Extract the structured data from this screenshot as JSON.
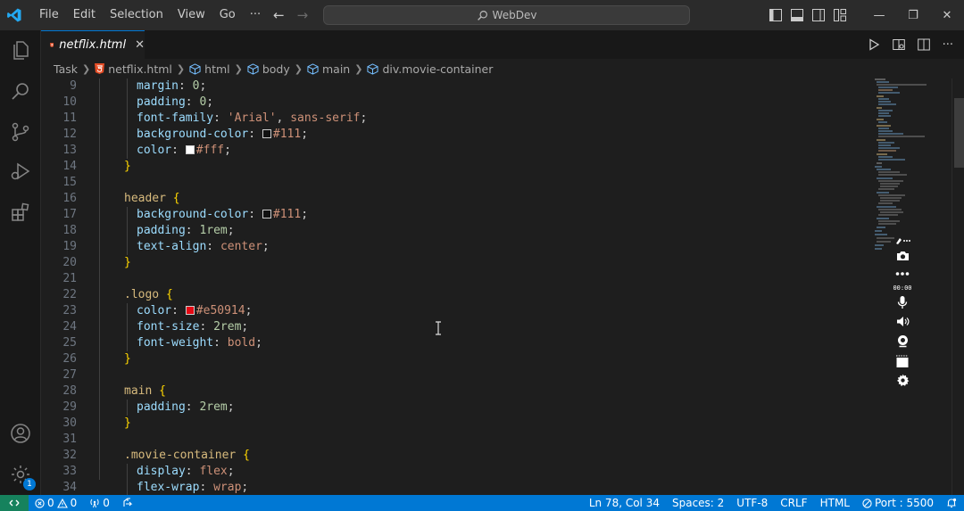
{
  "titlebar": {
    "menu": [
      "File",
      "Edit",
      "Selection",
      "View",
      "Go",
      "···"
    ],
    "search_text": "WebDev",
    "window_controls": [
      "—",
      "❐",
      "✕"
    ]
  },
  "tab": {
    "label": "netflix.html",
    "close": "✕"
  },
  "breadcrumb": [
    "Task",
    "netflix.html",
    "html",
    "body",
    "main",
    "div.movie-container"
  ],
  "code": [
    {
      "n": "9",
      "text": "margin: 0;"
    },
    {
      "n": "10",
      "text": "padding: 0;"
    },
    {
      "n": "11",
      "text": "font-family: 'Arial', sans-serif;"
    },
    {
      "n": "12",
      "text": "background-color: #111;"
    },
    {
      "n": "13",
      "text": "color: #fff;"
    },
    {
      "n": "14",
      "text": "}"
    },
    {
      "n": "15",
      "text": ""
    },
    {
      "n": "16",
      "text": "header {"
    },
    {
      "n": "17",
      "text": "background-color: #111;"
    },
    {
      "n": "18",
      "text": "padding: 1rem;"
    },
    {
      "n": "19",
      "text": "text-align: center;"
    },
    {
      "n": "20",
      "text": "}"
    },
    {
      "n": "21",
      "text": ""
    },
    {
      "n": "22",
      "text": ".logo {"
    },
    {
      "n": "23",
      "text": "color: #e50914;"
    },
    {
      "n": "24",
      "text": "font-size: 2rem;"
    },
    {
      "n": "25",
      "text": "font-weight: bold;"
    },
    {
      "n": "26",
      "text": "}"
    },
    {
      "n": "27",
      "text": ""
    },
    {
      "n": "28",
      "text": "main {"
    },
    {
      "n": "29",
      "text": "padding: 2rem;"
    },
    {
      "n": "30",
      "text": "}"
    },
    {
      "n": "31",
      "text": ""
    },
    {
      "n": "32",
      "text": ".movie-container {"
    },
    {
      "n": "33",
      "text": "display: flex;"
    },
    {
      "n": "34",
      "text": "flex-wrap: wrap;"
    }
  ],
  "floatbar": {
    "timer": "00:00"
  },
  "status": {
    "errors": "0",
    "warnings": "0",
    "ports": "0",
    "cursor": "Ln 78, Col 34",
    "spaces": "Spaces: 2",
    "encoding": "UTF-8",
    "eol": "CRLF",
    "language": "HTML",
    "port": "Port : 5500",
    "badge": "1"
  },
  "colors": {
    "accent": "#0078d4",
    "remote": "#16825d",
    "html_icon": "#e44d26",
    "swatch_111": "#111111",
    "swatch_fff": "#ffffff",
    "swatch_e50914": "#e50914"
  }
}
